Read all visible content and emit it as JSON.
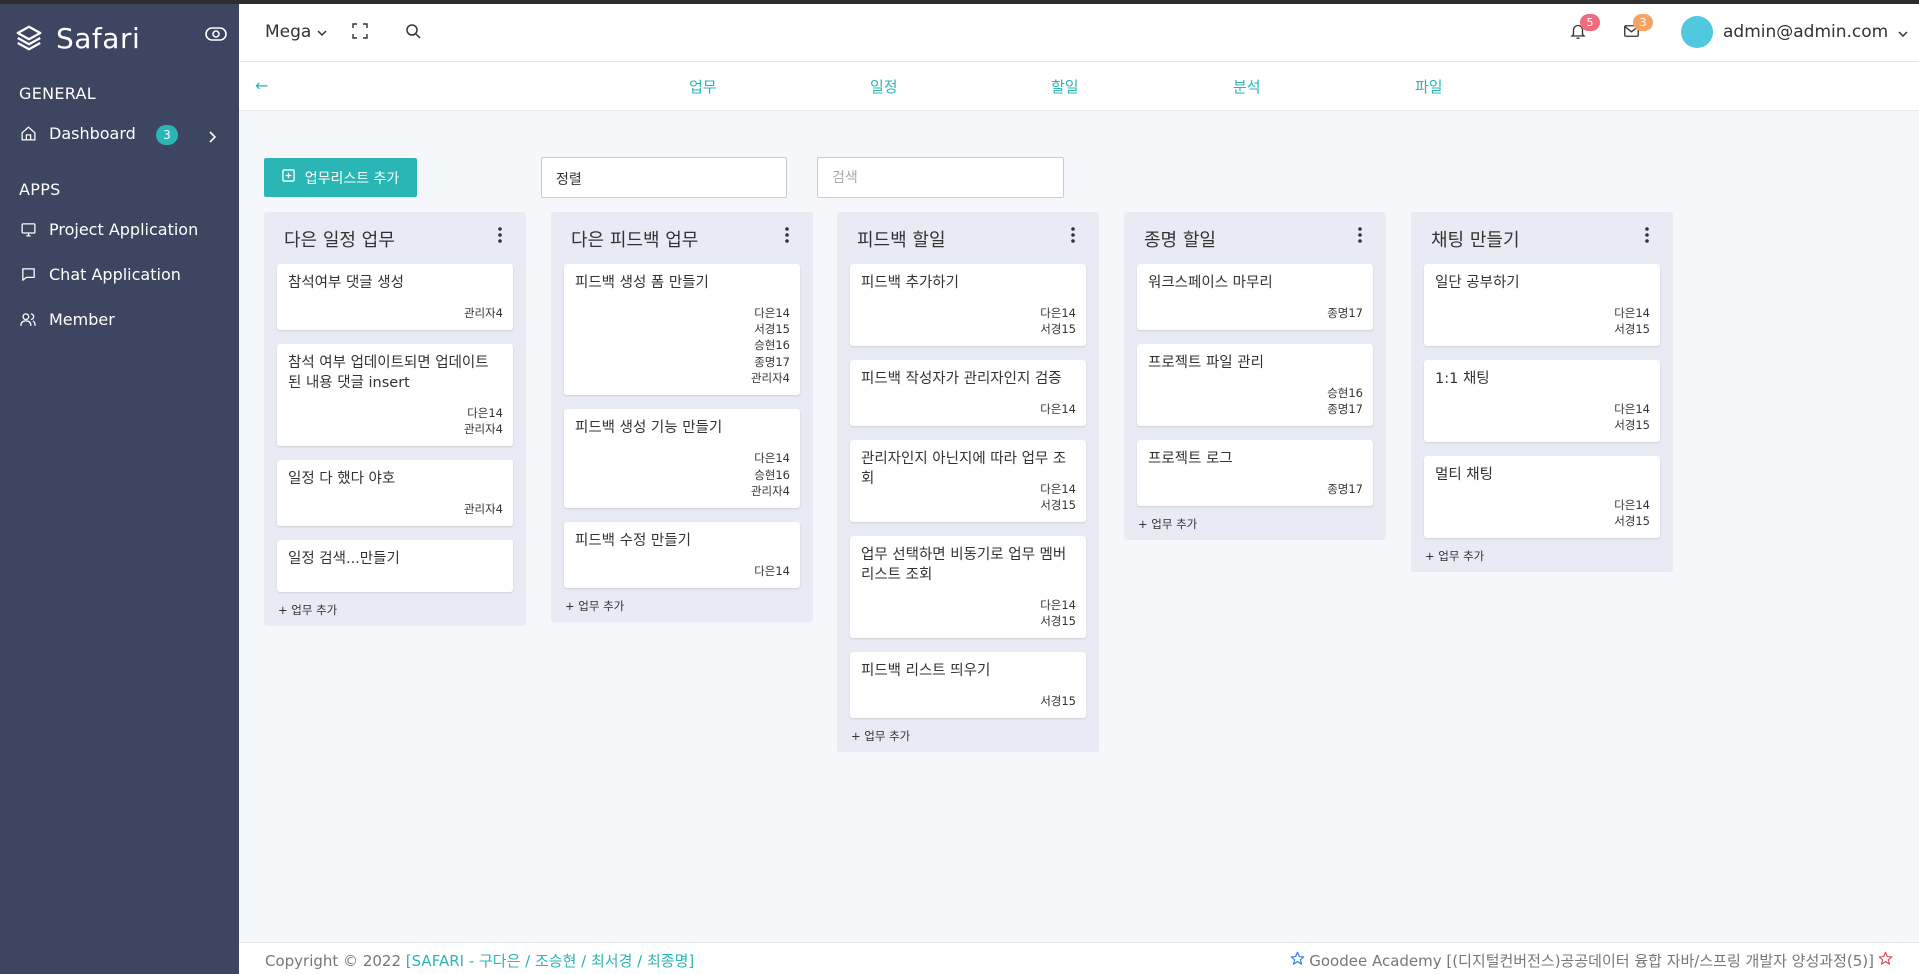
{
  "brand": {
    "name": "Safari"
  },
  "sidebar": {
    "general_label": "GENERAL",
    "apps_label": "APPS",
    "dashboard": {
      "label": "Dashboard",
      "badge": "3"
    },
    "apps": [
      {
        "label": "Project Application",
        "icon": "display-icon"
      },
      {
        "label": "Chat Application",
        "icon": "chat-icon"
      },
      {
        "label": "Member",
        "icon": "users-icon"
      }
    ]
  },
  "header": {
    "mega_label": "Mega",
    "notifications_count": "5",
    "messages_count": "3",
    "user_email": "admin@admin.com",
    "colors": {
      "notif_badge": "#f06b7c",
      "msg_badge": "#f4a363",
      "accent": "#2bb6b6"
    }
  },
  "subnav": {
    "back": "←",
    "tabs": [
      "업무",
      "일정",
      "할일",
      "분석",
      "파일"
    ]
  },
  "toolbar": {
    "add_list_label": "업무리스트 추가",
    "sort_label": "정렬",
    "search_placeholder": "검색"
  },
  "board": {
    "add_task_label": "+ 업무 추가",
    "columns": [
      {
        "title": "다은 일정 업무",
        "cards": [
          {
            "title": "참석여부 댓글 생성",
            "members": [
              "관리자4"
            ]
          },
          {
            "title": "참석 여부 업데이트되면 업데이트 된 내용 댓글 insert",
            "members": [
              "다은14",
              "관리자4"
            ]
          },
          {
            "title": "일정 다 했다 야호",
            "members": [
              "관리자4"
            ]
          },
          {
            "title": "일정 검색...만들기",
            "members": []
          }
        ]
      },
      {
        "title": "다은 피드백 업무",
        "cards": [
          {
            "title": "피드백 생성 폼 만들기",
            "members": [
              "다은14",
              "서경15",
              "승현16",
              "종명17",
              "관리자4"
            ]
          },
          {
            "title": "피드백 생성 기능 만들기",
            "members": [
              "다은14",
              "승현16",
              "관리자4"
            ]
          },
          {
            "title": "피드백 수정 만들기",
            "members": [
              "다은14"
            ]
          }
        ]
      },
      {
        "title": "피드백 할일",
        "cards": [
          {
            "title": "피드백 추가하기",
            "members": [
              "다은14",
              "서경15"
            ]
          },
          {
            "title": "피드백 작성자가 관리자인지 검증",
            "members": [
              "다은14"
            ]
          },
          {
            "title": "관리자인지 아닌지에 따라 업무 조회",
            "members": [
              "다은14",
              "서경15"
            ]
          },
          {
            "title": "업무 선택하면 비동기로 업무 멤버 리스트 조회",
            "members": [
              "다은14",
              "서경15"
            ]
          },
          {
            "title": "피드백 리스트 띄우기",
            "members": [
              "서경15"
            ]
          }
        ]
      },
      {
        "title": "종명 할일",
        "cards": [
          {
            "title": "워크스페이스 마무리",
            "members": [
              "종명17"
            ]
          },
          {
            "title": "프로젝트 파일 관리",
            "members": [
              "승현16",
              "종명17"
            ]
          },
          {
            "title": "프로젝트 로그",
            "members": [
              "종명17"
            ]
          }
        ]
      },
      {
        "title": "채팅 만들기",
        "cards": [
          {
            "title": "일단 공부하기",
            "members": [
              "다은14",
              "서경15"
            ]
          },
          {
            "title": "1:1 채팅",
            "members": [
              "다은14",
              "서경15"
            ]
          },
          {
            "title": "멀티 채팅",
            "members": [
              "다은14",
              "서경15"
            ]
          }
        ]
      }
    ]
  },
  "footer": {
    "copyright": "Copyright © 2022 ",
    "team": "[SAFARI - 구다은 / 조승현 / 최서경 / 최종명]",
    "academy": "Goodee Academy [(디지털컨버전스)공공데이터 융합 자바/스프링 개발자 양성과정(5)]"
  }
}
